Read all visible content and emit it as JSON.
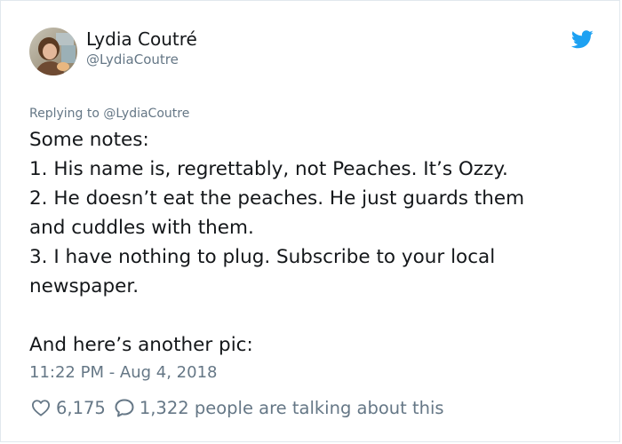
{
  "author": {
    "name": "Lydia Coutré",
    "handle": "@LydiaCoutre"
  },
  "reply": {
    "prefix": "Replying to",
    "to": "@LydiaCoutre"
  },
  "tweet": {
    "lines": [
      "Some notes:",
      "1. His name is, regrettably, not Peaches. It’s Ozzy.",
      "2. He doesn’t eat the peaches. He just guards them",
      "and cuddles with them.",
      "3. I have nothing to plug. Subscribe to your local",
      "newspaper."
    ],
    "closing": "And here’s another pic:"
  },
  "timestamp": "11:22 PM - Aug 4, 2018",
  "stats": {
    "likes": "6,175",
    "talking": "1,322 people are talking about this"
  },
  "colors": {
    "brand_blue": "#1da1f2",
    "secondary_text": "#657786",
    "primary_text": "#14171a",
    "border": "#e1e8ed"
  },
  "icons": {
    "brand": "twitter-bird-icon",
    "like": "heart-icon",
    "reply": "comment-icon"
  }
}
